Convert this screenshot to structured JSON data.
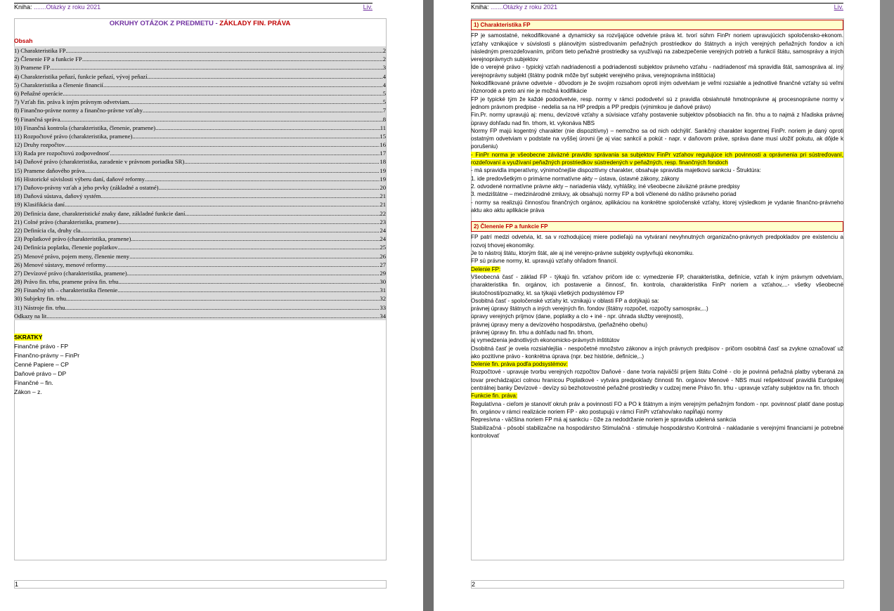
{
  "header": {
    "kniha_label": "Kniha:",
    "kniha_value": ".......Otázky z roku 2021",
    "liv": "Liv."
  },
  "page1": {
    "title_main": "OKRUHY OTÁZOK Z PREDMETU -",
    "title_accent": "ZÁKLADY FIN.   PRÁVA",
    "obsah_label": "Obsah",
    "toc": [
      {
        "t": "1) Charakteristika FP",
        "n": "2"
      },
      {
        "t": "2) Členenie FP a funkcie FP",
        "n": "2"
      },
      {
        "t": "3) Pramene FP",
        "n": "3"
      },
      {
        "t": "4) Charakteristika peňazí, funkcie peňazí, vývoj peňazí",
        "n": "4"
      },
      {
        "t": "5) Charakteristika a členenie financií",
        "n": "4"
      },
      {
        "t": "6) Peňažné operácie",
        "n": "5"
      },
      {
        "t": "7) Vzťah fin.   práva k iným právnym odvetviam",
        "n": "5"
      },
      {
        "t": "8) Finančno-právne normy a finančno-právne vzťahy",
        "n": "7"
      },
      {
        "t": "9) Finančná správa",
        "n": "8"
      },
      {
        "t": "10) Finančná kontrola (charakteristika, členenie, pramene)",
        "n": "11"
      },
      {
        "t": "11) Rozpočtové právo (charakteristika, pramene)",
        "n": "15"
      },
      {
        "t": "12) Druhy rozpočtov",
        "n": "16"
      },
      {
        "t": "13) Rada pre rozpočtovú zodpovednosť",
        "n": "17"
      },
      {
        "t": "14) Daňové právo (charakteristika, zaradenie v právnom poriadku SR)",
        "n": "18"
      },
      {
        "t": "15) Pramene daňového práva",
        "n": "19"
      },
      {
        "t": "16) Historické súvislosti výberu daní, daňové reformy",
        "n": "19"
      },
      {
        "t": "17) Daňovo-právny vzťah a jeho prvky (základné a ostatné)",
        "n": "20"
      },
      {
        "t": "18) Daňová sústava, daňový systém",
        "n": "21"
      },
      {
        "t": "19) Klasifikácia daní",
        "n": "21"
      },
      {
        "t": "20) Definícia dane, charakteristické znaky dane, základné funkcie daní",
        "n": "22"
      },
      {
        "t": "21) Colné právo (charakteristika, pramene)",
        "n": "23"
      },
      {
        "t": "22) Definícia cla, druhy cla",
        "n": "24"
      },
      {
        "t": "23) Poplatkové právo (charakteristika, pramene)",
        "n": "24"
      },
      {
        "t": "24) Definícia poplatku, členenie poplatkov",
        "n": "25"
      },
      {
        "t": "25) Menové právo, pojem meny, členenie meny",
        "n": "26"
      },
      {
        "t": "26) Menové sústavy, menové reformy",
        "n": "27"
      },
      {
        "t": "27) Devízové právo (charakteristika, pramene)",
        "n": "29"
      },
      {
        "t": "28) Právo fin.   trhu, pramene práva fin.   trhu",
        "n": "30"
      },
      {
        "t": "29) Finančný trh – charakteristika členenie",
        "n": "31"
      },
      {
        "t": "30) Subjekty fin.   trhu",
        "n": "32"
      },
      {
        "t": "31) Nástroje fin.   trhu",
        "n": "33"
      },
      {
        "t": "Odkazy na lit.",
        "n": "34"
      }
    ],
    "skratky_title": "SKRATKY",
    "skratky": [
      "Finančné právo - FP",
      "Finančno-právny – FinPr",
      "Cenné Papiere – CP",
      "Daňové právo – DP",
      "Finančné – fin.",
      "Zákon – z."
    ],
    "page_number": "1"
  },
  "page2": {
    "sec1_title": "1) Charakteristika FP",
    "sec1_paras": [
      "FP je samostatné, nekodifikované a dynamicky sa rozvíjajúce odvetvie práva kt. tvorí súhrn FinPr noriem upravujúcich spoločensko-ekonom. vzťahy vznikajúce v súvislosti s plánovitým sústreďovaním peňažných prostriedkov do štátnych a iných verejných peňažných fondov a ich následným prerozdeľovaním, pričom tieto peňažné prostriedky sa využívajú na zabezpečenie verejných potrieb a funkcií štátu, samosprávy a iných verejnoprávnych subjektov",
      "Ide o verejné právo - typický vzťah nadriadenosti a podriadenosti subjektov právneho vzťahu - nadriadenosť má spravidla štát, samospráva al. iný verejnoprávny subjekt (štátny podnik môže byť subjekt verejného práva, verejnoprávna inštitúcia)",
      "Nekodifikované právne odvetvie - dôvodom je že svojim rozsahom oproti iným odvetviam je veľmi rozsiahle a jednotlivé finančné vzťahy sú veľmi rôznorodé a preto ani nie je možná kodifikácie",
      "FP je typické tým že každé pododvetvie, resp. normy v rámci pododvetví sú z pravidla obsiahnuté hmotnoprávne aj procesnoprávne normy v jednom právnom predpise - nedelia sa na HP predpis a PP predpis (výnimkou je daňové právo)",
      "Fin.Pr. normy upravujú aj: menu, devízové vzťahy a súvisiace vzťahy  postavenie subjektov pôsobiacich na fin. trhu a to najmä z hľadiska právnej úpravy dohľadu nad fin. trhom, kt. vykonáva NBS",
      "Normy FP majú kogentný charakter (nie dispozitívny) – nemožno sa od nich odchýliť. Sankčný charakter kogentnej FinPr. noriem je daný oproti ostatným odvetviam v podstate na vyššej úrovni (je aj viac sankcií a pokút - napr. v daňovom práve, správa dane musí uložiť pokutu, ak dôjde k porušeniu)",
      "- FinPr norma je všeobecne záväzné pravidlo správania sa subjektov FinPr vzťahov regulujúce ich povinnosti a oprávnenia pri sústreďovaní, rozdeľovaní a využívaní peňažných prostriedkov sústredených v peňažných, resp. finančných fondoch",
      "- má spravidla imperatívny, výnimočnejšie dispozitívny charakter, obsahuje spravidla majetkovú sankciu - Štruktúra:",
      "1. ide predovšetkým o primárne normatívne akty – ústava, ústavné zákony, zákony",
      "2. odvodené normatívne právne akty – nariadenia vlády, vyhlášky, iné všeobecne záväzné právne predpisy",
      "3. medzištátne – medzinárodné zmluvy, ak obsahujú normy FP a boli včlenené do nášho právneho poriad",
      "- normy sa realizujú činnosťou finančných orgánov, aplikáciou na konkrétne spoločenské vzťahy, ktorej výsledkom je vydanie finančno-právneho aktu ako aktu aplikácie práva"
    ],
    "sec2_title": "2) Členenie FP a funkcie FP",
    "sec2_paras": [
      "FP patrí medzi odvetvia, kt. sa v rozhodujúcej miere podieľajú na vytváraní nevyhnutných organizačno-právnych predpokladov pre existenciu a rozvoj trhovej ekonomiky.",
      "Je to nástroj štátu, ktorým štát, ale aj iné verejno-právne subjekty ovplyvňujú ekonomiku.",
      "FP sú právne normy, kt. upravujú vzťahy ohľadom financií.",
      "Delenie FP:",
      "Všeobecná časť - základ FP - týkajú fin. vzťahov pričom ide o: vymedzenie FP, charakteristika, definície, vzťah k iným právnym odvetviam, charakteristika fin. orgánov, ich postavenie a činnosť, fin. kontrola, charakteristika FinPr noriem a vzťahov,...- všetky všeobecné skutočnosti/poznatky, kt. sa týkajú všetkých podsystémov FP",
      "Osobitná časť - spoločenské vzťahy kt. vznikajú v oblasti FP a dotýkajú sa:",
      "právnej úpravy štátnych a iných verejných fin. fondov (štátny rozpočet, rozpočty samospráv,...)",
      "úpravy verejných príjmov (dane, poplatky a clo + iné - npr. úhrada služby verejnosti),",
      "právnej úpravy meny a devízového hospodárstva, (peňažného obehu)",
      "právnej úpravy fin. trhu a dohľadu nad fin. trhom,",
      "aj vymedzenia jednotlivých ekonomicko-právnych inštitútov",
      "Osobitná časť je ovela rozsiahlejšia - nespočetné množstvo zákonov a iných právnych predpisov - pričom osobitná časť sa zvykne označovať už ako pozitívne právo - konkrétna úprava (npr. bez histórie, definície,..)",
      "Delenie fin.   práva podľa podsystémov:",
      "Rozpočtové - upravuje tvorbu verejných rozpočtov  Daňové - dane tvoria najväčší príjem štátu  Colné - clo je povinná peňažná platby vyberaná za tovar prechádzajúci colnou hranicou  Poplatkové - vytvára predpoklady činnosti fin. orgánov  Menové - NBS musí rešpektovať pravidlá Európskej centrálnej banky  Devízové - devízy sú bezhotovostné peňažné prostriedky v cudzej mene  Právo fin.   trhu - upravuje vzťahy subjektov na fin. trhoch",
      "Funkcie fin.   práva:",
      "Regulatívna - cieľom je stanoviť okruh práv a povinností FO a PO k štátnym a iným verejným peňažným fondom - npr. povinnosť platiť dane  postup fin. orgánov v rámci realizácie noriem FP - ako postupujú v rámci FinPr vzťahov/ako napĺňajú normy",
      "Represívna - väčšina noriem FP má aj sankciu - čiže za nedodržanie noriem je spravidla udelená sankcia",
      "Stabilizačná - pôsobí stabilizačne na hospodárstvo  Stimulačná - stimuluje hospodárstvo  Kontrolná - nakladanie s verejnými financiami je potrebné kontrolovať"
    ],
    "page_number": "2"
  }
}
